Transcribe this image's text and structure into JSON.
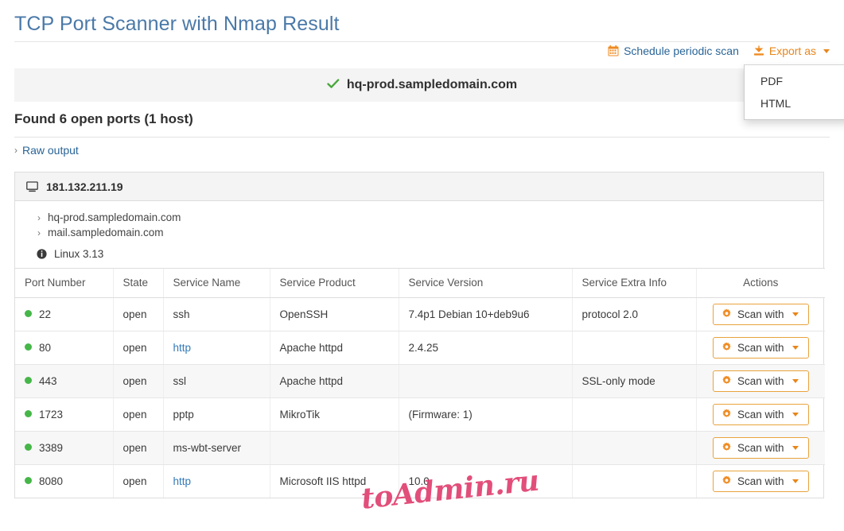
{
  "page": {
    "title": "TCP Port Scanner with Nmap Result",
    "found_heading": "Found 6 open ports (1 host)",
    "raw_output_label": "Raw output",
    "watermark": "toAdmin.ru"
  },
  "toolbar": {
    "schedule_label": "Schedule periodic scan",
    "schedule_icon": "calendar-icon",
    "export_label": "Export as",
    "export_icon": "download-icon",
    "export_menu": [
      "PDF",
      "HTML"
    ]
  },
  "banner": {
    "status_icon": "check-icon",
    "host": "hq-prod.sampledomain.com"
  },
  "host_panel": {
    "ip_icon": "desktop-icon",
    "ip": "181.132.211.19",
    "hostnames": [
      "hq-prod.sampledomain.com",
      "mail.sampledomain.com"
    ],
    "os_icon": "info-icon",
    "os": "Linux 3.13"
  },
  "table": {
    "headers": [
      "Port Number",
      "State",
      "Service Name",
      "Service Product",
      "Service Version",
      "Service Extra Info",
      "Actions"
    ],
    "action_button": {
      "label": "Scan with",
      "icon": "gear-icon"
    },
    "rows": [
      {
        "port": "22",
        "state": "open",
        "service_name": "ssh",
        "service_name_link": false,
        "service_product": "OpenSSH",
        "service_version": "7.4p1 Debian 10+deb9u6",
        "service_extra": "protocol 2.0",
        "status_color": "#46b649",
        "striped": false
      },
      {
        "port": "80",
        "state": "open",
        "service_name": "http",
        "service_name_link": true,
        "service_product": "Apache httpd",
        "service_version": "2.4.25",
        "service_extra": "",
        "status_color": "#46b649",
        "striped": false
      },
      {
        "port": "443",
        "state": "open",
        "service_name": "ssl",
        "service_name_link": false,
        "service_product": "Apache httpd",
        "service_version": "",
        "service_extra": "SSL-only mode",
        "status_color": "#46b649",
        "striped": true
      },
      {
        "port": "1723",
        "state": "open",
        "service_name": "pptp",
        "service_name_link": false,
        "service_product": "MikroTik",
        "service_version": "(Firmware: 1)",
        "service_extra": "",
        "status_color": "#46b649",
        "striped": false
      },
      {
        "port": "3389",
        "state": "open",
        "service_name": "ms-wbt-server",
        "service_name_link": false,
        "service_product": "",
        "service_version": "",
        "service_extra": "",
        "status_color": "#46b649",
        "striped": true
      },
      {
        "port": "8080",
        "state": "open",
        "service_name": "http",
        "service_name_link": true,
        "service_product": "Microsoft IIS httpd",
        "service_version": "10.0",
        "service_extra": "",
        "status_color": "#46b649",
        "striped": false
      }
    ]
  },
  "colors": {
    "title_blue": "#4a79a8",
    "link_blue": "#2a6496",
    "accent_orange": "#e8861a",
    "status_green": "#46b649",
    "watermark_pink": "#e0406f"
  }
}
